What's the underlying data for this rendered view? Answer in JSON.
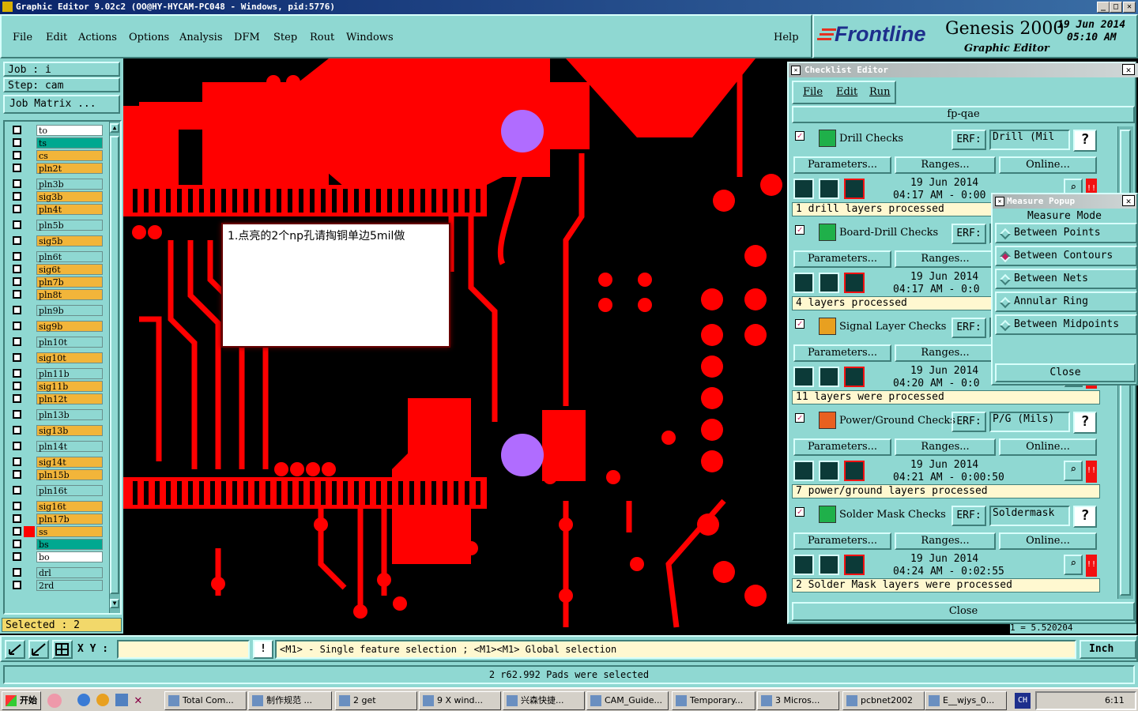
{
  "window": {
    "title": "Graphic Editor 9.02c2  (OO@HY-HYCAM-PC048 - Windows, pid:5776)"
  },
  "menu": [
    "File",
    "Edit",
    "Actions",
    "Options",
    "Analysis",
    "DFM",
    "Step",
    "Rout",
    "Windows"
  ],
  "help_label": "Help",
  "brand": {
    "logo": "Frontline",
    "product": "Genesis 2000",
    "subtitle": "Graphic Editor",
    "date": "19 Jun 2014",
    "time": "05:10 AM"
  },
  "job": {
    "job_label": "Job  :  i",
    "step_label": "Step:  cam",
    "matrix_button": "Job Matrix ..."
  },
  "layers": [
    {
      "name": "to",
      "color": "#ffffff"
    },
    {
      "name": "ts",
      "color": "#00a890"
    },
    {
      "name": "cs",
      "color": "#f2b53a"
    },
    {
      "name": "pln2t",
      "color": "#f2b53a"
    },
    {
      "name": "pln3b",
      "color": "#8fd8d2"
    },
    {
      "name": "sig3b",
      "color": "#f2b53a"
    },
    {
      "name": "pln4t",
      "color": "#f2b53a"
    },
    {
      "name": "pln5b",
      "color": "#8fd8d2"
    },
    {
      "name": "sig5b",
      "color": "#f2b53a"
    },
    {
      "name": "pln6t",
      "color": "#8fd8d2"
    },
    {
      "name": "sig6t",
      "color": "#f2b53a"
    },
    {
      "name": "pln7b",
      "color": "#f2b53a"
    },
    {
      "name": "pln8t",
      "color": "#f2b53a"
    },
    {
      "name": "pln9b",
      "color": "#8fd8d2"
    },
    {
      "name": "sig9b",
      "color": "#f2b53a"
    },
    {
      "name": "pln10t",
      "color": "#8fd8d2"
    },
    {
      "name": "sig10t",
      "color": "#f2b53a"
    },
    {
      "name": "pln11b",
      "color": "#8fd8d2"
    },
    {
      "name": "sig11b",
      "color": "#f2b53a"
    },
    {
      "name": "pln12t",
      "color": "#f2b53a"
    },
    {
      "name": "pln13b",
      "color": "#8fd8d2"
    },
    {
      "name": "sig13b",
      "color": "#f2b53a"
    },
    {
      "name": "pln14t",
      "color": "#8fd8d2"
    },
    {
      "name": "sig14t",
      "color": "#f2b53a"
    },
    {
      "name": "pln15b",
      "color": "#f2b53a"
    },
    {
      "name": "pln16t",
      "color": "#8fd8d2"
    },
    {
      "name": "sig16t",
      "color": "#f2b53a"
    },
    {
      "name": "pln17b",
      "color": "#f2b53a"
    },
    {
      "name": "ss",
      "color": "#f2b53a"
    },
    {
      "name": "bs",
      "color": "#00a890"
    },
    {
      "name": "bo",
      "color": "#ffffff"
    },
    {
      "name": "drl",
      "color": "#8fd8d2"
    },
    {
      "name": "2rd",
      "color": "#8fd8d2"
    }
  ],
  "selected_label": "Selected : 2",
  "note": {
    "text": "1.点亮的2个np孔请掏铜单边5mil做"
  },
  "checklist": {
    "title": "Checklist Editor",
    "menu": [
      "File",
      "Edit",
      "Run"
    ],
    "name": "fp-qae",
    "erf_label": "ERF:",
    "params_label": "Parameters...",
    "ranges_label": "Ranges...",
    "online_label": "Online...",
    "close_label": "Close",
    "checks": [
      {
        "name": "Drill Checks",
        "erf": "Drill (Mil",
        "date": "19 Jun 2014",
        "time": "04:17 AM - 0:00",
        "status": "1 drill layers processed"
      },
      {
        "name": "Board-Drill Checks",
        "erf": "",
        "date": "19 Jun 2014",
        "time": "04:17 AM - 0:0",
        "status": "4 layers processed"
      },
      {
        "name": "Signal Layer Checks",
        "erf": "",
        "date": "19 Jun 2014",
        "time": "04:20 AM - 0:0",
        "status": "11 layers were processed"
      },
      {
        "name": "Power/Ground Checks",
        "erf": "P/G (Mils)",
        "date": "19 Jun 2014",
        "time": "04:21 AM - 0:00:50",
        "status": "7 power/ground layers processed"
      },
      {
        "name": "Solder Mask Checks",
        "erf": "Soldermask",
        "date": "19 Jun 2014",
        "time": "04:24 AM - 0:02:55",
        "status": "2 Solder Mask layers were processed"
      }
    ],
    "accent": "#f21111"
  },
  "measure": {
    "title": "Measure Popup",
    "header": "Measure Mode",
    "options": [
      "Between Points",
      "Between Contours",
      "Between Nets",
      "Annular Ring",
      "Between Midpoints"
    ],
    "selected": "Between Contours",
    "close_label": "Close",
    "readout": "1 = 5.520204"
  },
  "bottom": {
    "xy_label": "X Y :",
    "xy_value": "",
    "message": "<M1> - Single feature selection ; <M1><M1> Global selection",
    "units": "Inch"
  },
  "status": "2 r62.992 Pads were selected",
  "taskbar": {
    "start": "开始",
    "tasks": [
      "Total Com...",
      "制作规范 ...",
      "2 get",
      "9 X wind...",
      "兴森快捷...",
      "CAM_Guide...",
      "Temporary...",
      "3 Micros...",
      "pcbnet2002",
      "E__wjys_0..."
    ],
    "lang": "CH",
    "clock": "6:11"
  },
  "colors": {
    "panel": "#8fd8d2",
    "copper": "#ff0000",
    "npth_hole": "#b06cff",
    "board": "#000000"
  }
}
